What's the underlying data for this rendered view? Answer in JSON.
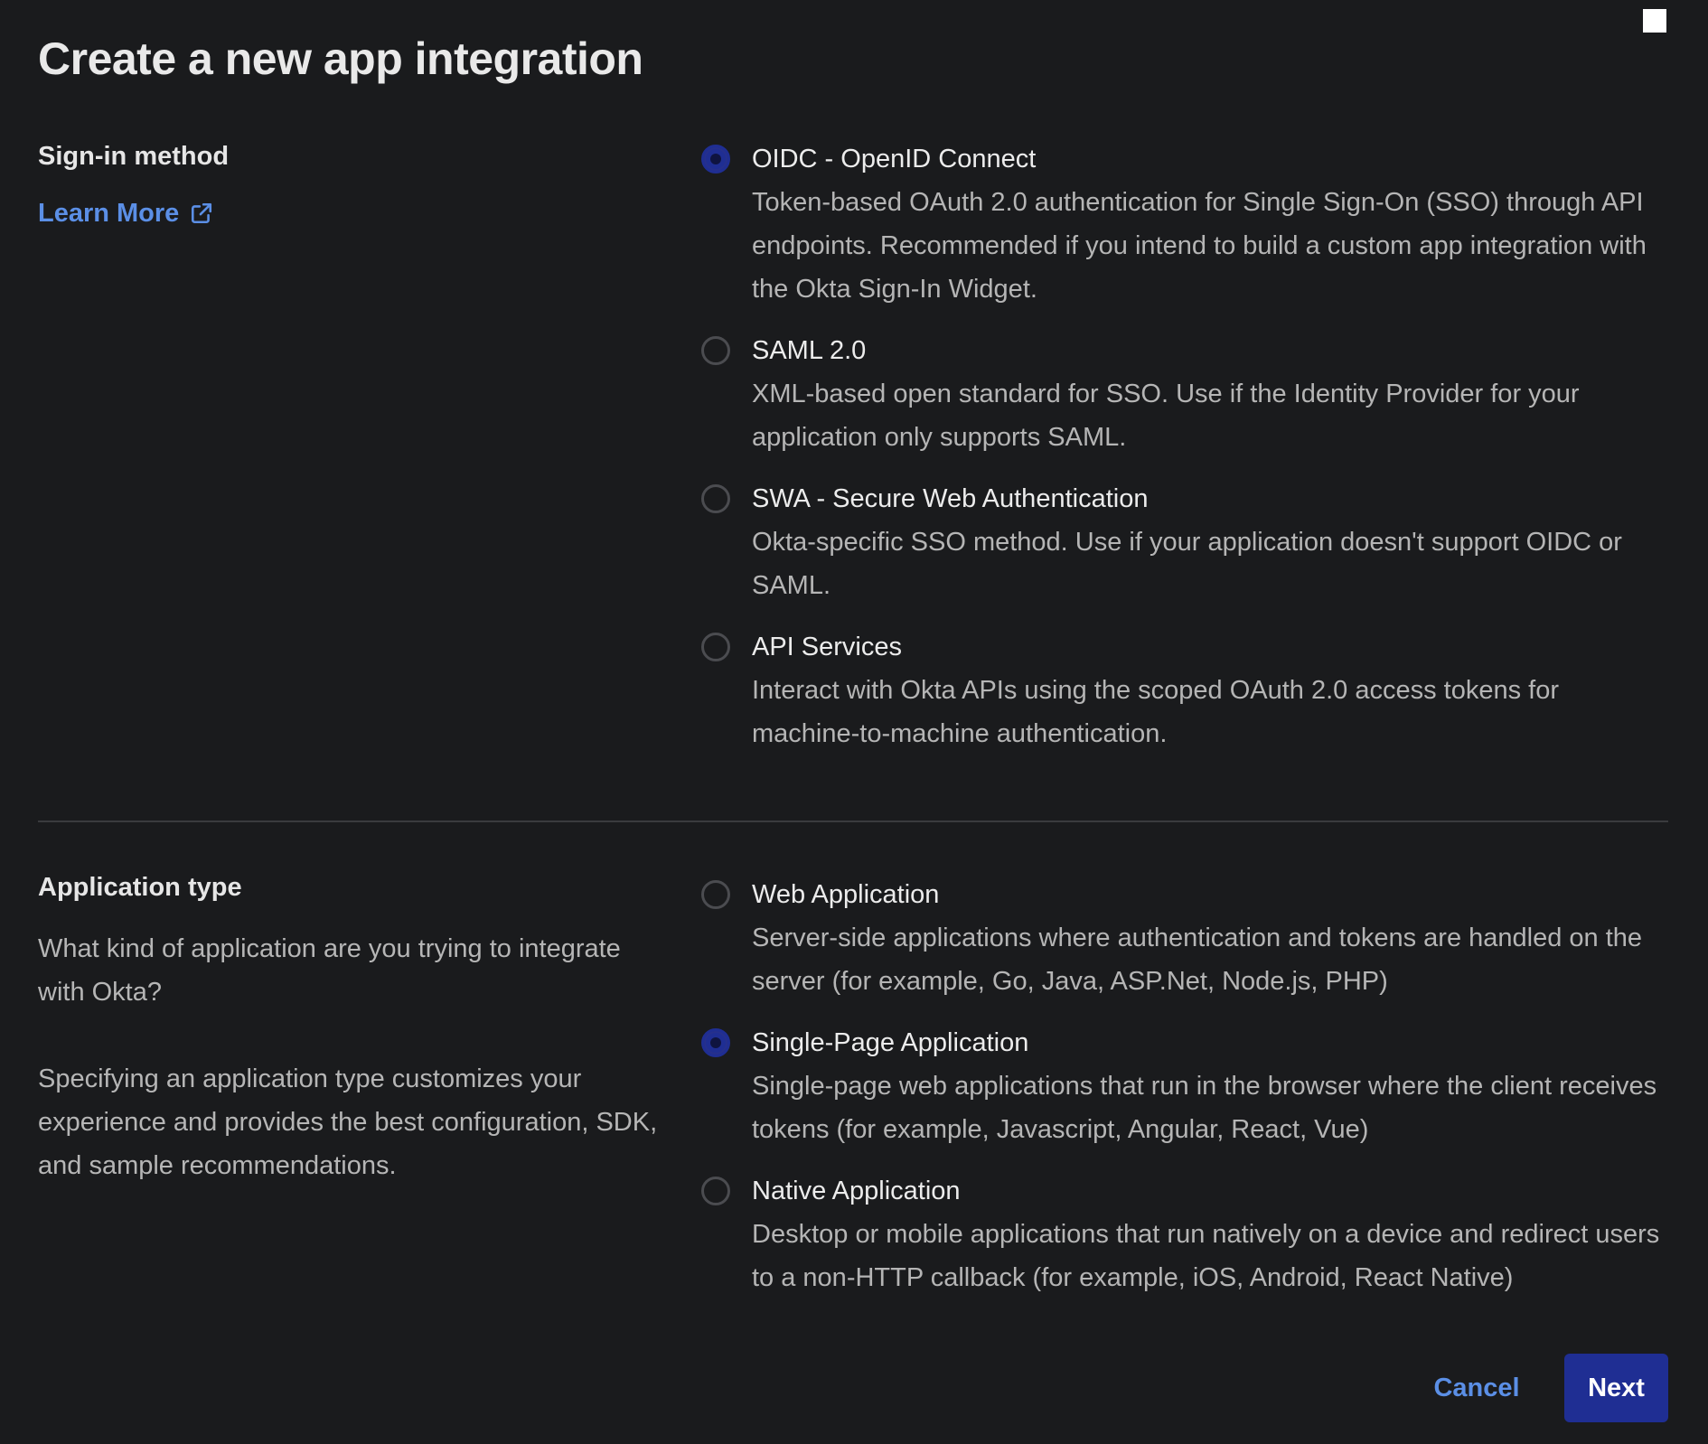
{
  "dialog": {
    "title": "Create a new app integration",
    "close_icon": "close-icon"
  },
  "sign_in": {
    "label": "Sign-in method",
    "learn_more": "Learn More",
    "learn_more_icon": "external-link-icon",
    "options": [
      {
        "title": "OIDC - OpenID Connect",
        "description": "Token-based OAuth 2.0 authentication for Single Sign-On (SSO) through API endpoints. Recommended if you intend to build a custom app integration with the Okta Sign-In Widget.",
        "selected": true
      },
      {
        "title": "SAML 2.0",
        "description": "XML-based open standard for SSO. Use if the Identity Provider for your application only supports SAML.",
        "selected": false
      },
      {
        "title": "SWA - Secure Web Authentication",
        "description": "Okta-specific SSO method. Use if your application doesn't support OIDC or SAML.",
        "selected": false
      },
      {
        "title": "API Services",
        "description": "Interact with Okta APIs using the scoped OAuth 2.0 access tokens for machine-to-machine authentication.",
        "selected": false
      }
    ]
  },
  "app_type": {
    "label": "Application type",
    "question": "What kind of application are you trying to integrate with Okta?",
    "explanation": "Specifying an application type customizes your experience and provides the best configuration, SDK, and sample recommendations.",
    "options": [
      {
        "title": "Web Application",
        "description": "Server-side applications where authentication and tokens are handled on the server (for example, Go, Java, ASP.Net, Node.js, PHP)",
        "selected": false
      },
      {
        "title": "Single-Page Application",
        "description": "Single-page web applications that run in the browser where the client receives tokens (for example, Javascript, Angular, React, Vue)",
        "selected": true
      },
      {
        "title": "Native Application",
        "description": "Desktop or mobile applications that run natively on a device and redirect users to a non-HTTP callback (for example, iOS, Android, React Native)",
        "selected": false
      }
    ]
  },
  "footer": {
    "cancel": "Cancel",
    "next": "Next"
  },
  "colors": {
    "background": "#1a1b1d",
    "accent": "#1f2e93",
    "link": "#5b8fe6"
  }
}
